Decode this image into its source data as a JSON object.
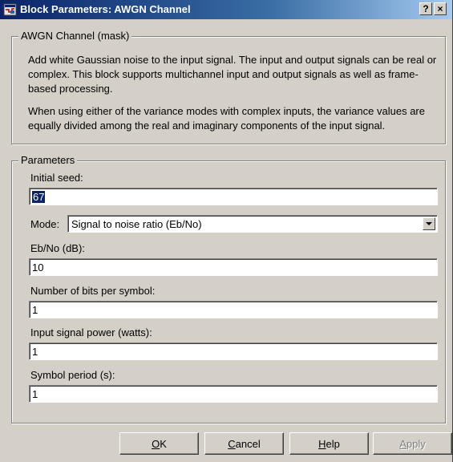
{
  "window": {
    "title": "Block Parameters: AWGN Channel",
    "help_button": "?",
    "close_button": "×"
  },
  "description": {
    "legend": "AWGN Channel (mask)",
    "paragraph1": "Add white Gaussian noise to the input signal. The input and output signals can be real or complex. This block supports multichannel input and output signals as well as frame-based processing.",
    "paragraph2": "When using either of the variance modes with complex inputs, the variance values are equally divided among the real and imaginary components of the input signal."
  },
  "parameters": {
    "legend": "Parameters",
    "initial_seed_label": "Initial seed:",
    "initial_seed_value": "67",
    "mode_label": "Mode:",
    "mode_value": "Signal to noise ratio  (Eb/No)",
    "ebno_label": "Eb/No (dB):",
    "ebno_value": "10",
    "bits_per_symbol_label": "Number of bits per symbol:",
    "bits_per_symbol_value": "1",
    "signal_power_label": "Input signal power (watts):",
    "signal_power_value": "1",
    "symbol_period_label": "Symbol period (s):",
    "symbol_period_value": "1"
  },
  "buttons": {
    "ok_mnemonic": "O",
    "ok_rest": "K",
    "cancel_mnemonic": "C",
    "cancel_rest": "ancel",
    "help_mnemonic": "H",
    "help_rest": "elp",
    "apply_mnemonic": "A",
    "apply_rest": "pply"
  },
  "colors": {
    "titlebar_start": "#0a246a",
    "titlebar_end": "#a6caf0",
    "dialog_face": "#d4d0c8",
    "selection": "#0a246a"
  },
  "icons": {
    "app": "simulink-block-icon",
    "dropdown": "chevron-down-icon"
  }
}
